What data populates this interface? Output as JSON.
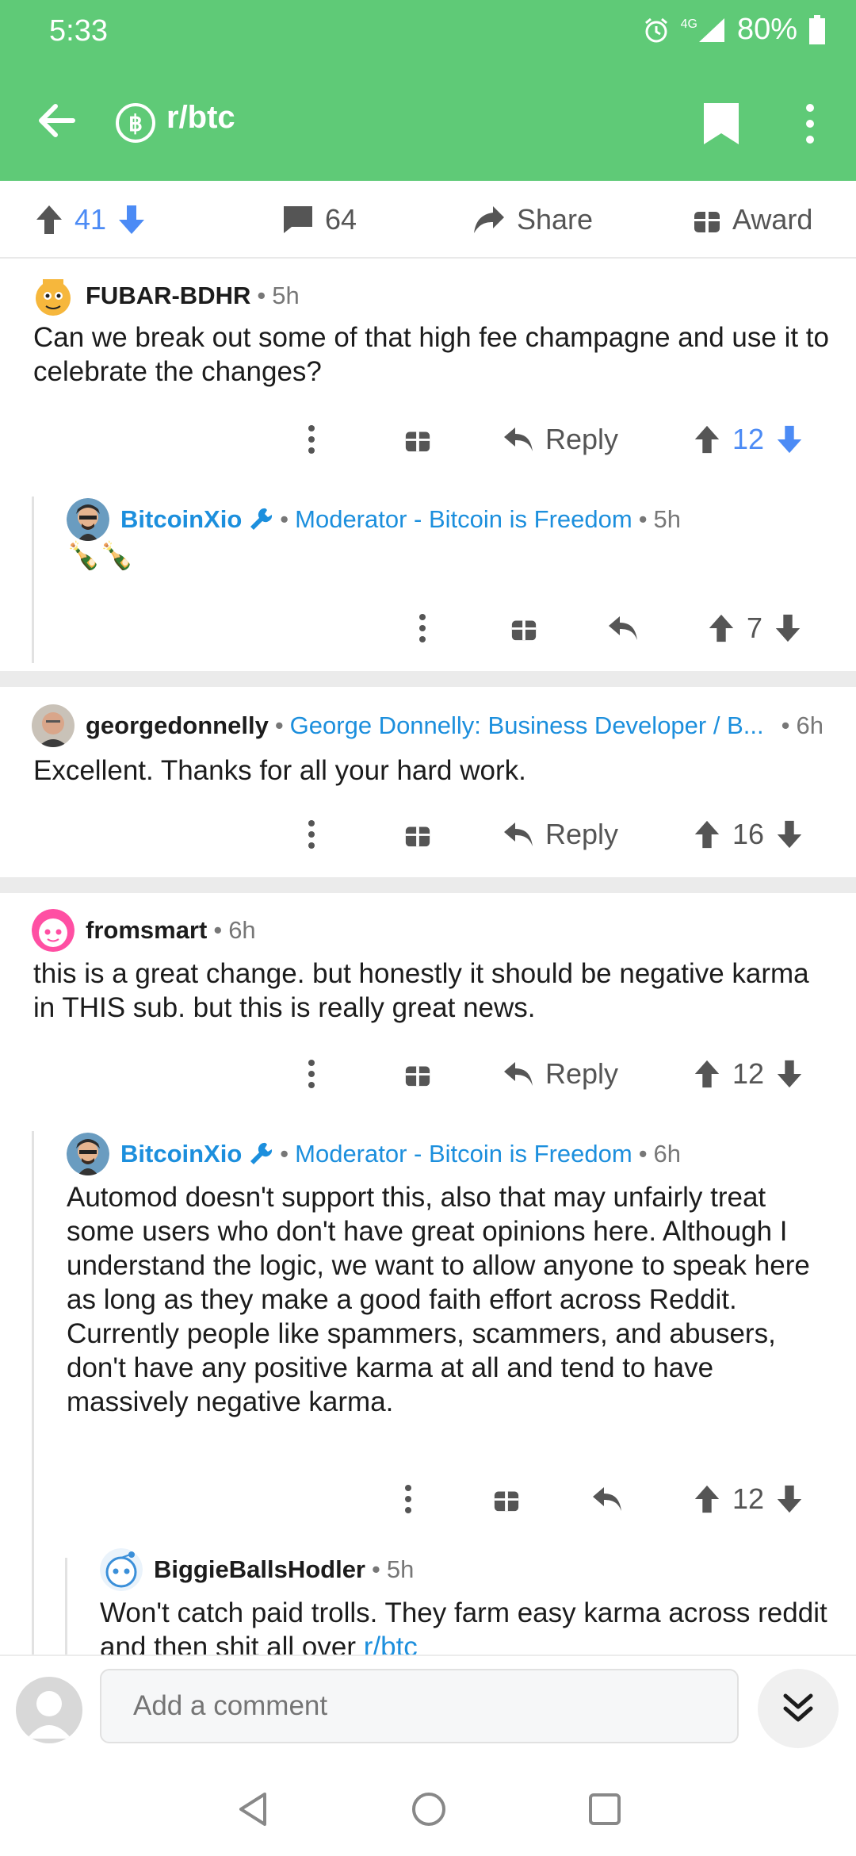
{
  "status": {
    "time": "5:33",
    "network": "4G",
    "battery": "80%"
  },
  "appbar": {
    "subreddit": "r/btc",
    "sub_icon_glyph": "฿"
  },
  "actions": {
    "upvotes": "41",
    "comments": "64",
    "share": "Share",
    "award": "Award"
  },
  "labels": {
    "reply": "Reply",
    "sep": "•"
  },
  "comments": [
    {
      "user": "FUBAR-BDHR",
      "time": "5h",
      "body": "Can we break out some of that high fee champagne and use it to celebrate the changes?",
      "score": "12"
    },
    {
      "user": "BitcoinXio",
      "flair": "Moderator - Bitcoin is Freedom",
      "time": "5h",
      "body": "🍾🍾",
      "score": "7"
    },
    {
      "user": "georgedonnelly",
      "flair": "George Donnelly: Business Developer / B...",
      "time": "6h",
      "body": "Excellent. Thanks for all your hard work.",
      "score": "16"
    },
    {
      "user": "fromsmart",
      "time": "6h",
      "body": "this is a great change. but honestly it should be negative karma in THIS sub. but this is really great news.",
      "score": "12"
    },
    {
      "user": "BitcoinXio",
      "flair": "Moderator - Bitcoin is Freedom",
      "time": "6h",
      "body": "Automod doesn't support this, also that may unfairly treat some users who don't have great opinions here. Although I understand the logic, we want to allow anyone to speak here as long as they make a good faith effort across Reddit. Currently people like spammers, scammers, and abusers, don't have any positive karma at all and tend to have massively negative karma.",
      "score": "12"
    },
    {
      "user": "BiggieBallsHodler",
      "time": "5h",
      "body_prefix": "Won't catch paid trolls. They farm easy karma across reddit and then shit all over ",
      "body_link": "r/btc"
    }
  ],
  "bottom": {
    "comment_placeholder": "Add a comment"
  },
  "colors": {
    "header_green": "#5fca77",
    "upvote_blue": "#4c8bf5",
    "flair_blue": "#1c8fdd"
  }
}
